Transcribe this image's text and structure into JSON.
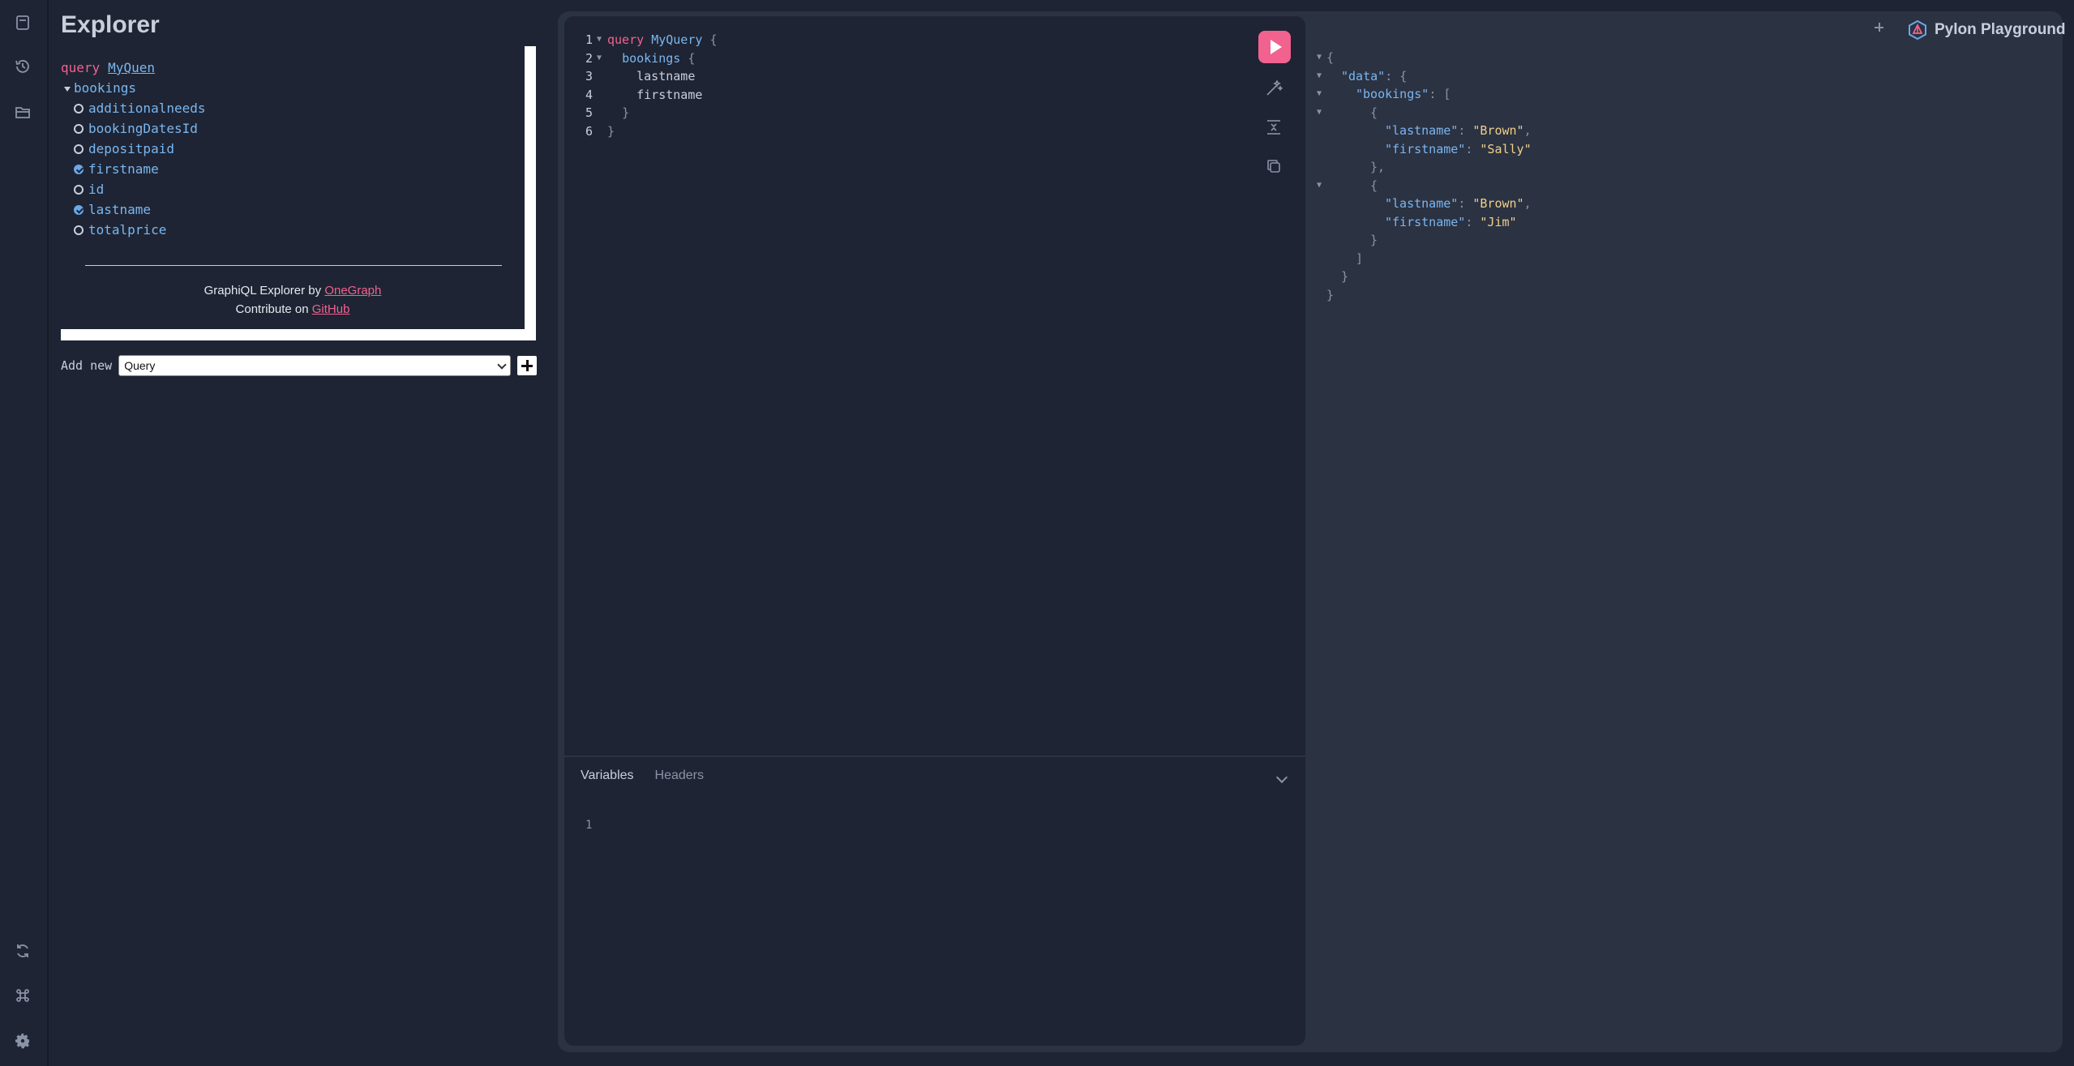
{
  "explorer": {
    "title": "Explorer",
    "operation_keyword": "query",
    "operation_name": "MyQuen",
    "root_field": "bookings",
    "fields": [
      {
        "name": "additionalneeds",
        "checked": false
      },
      {
        "name": "bookingDatesId",
        "checked": false
      },
      {
        "name": "depositpaid",
        "checked": false
      },
      {
        "name": "firstname",
        "checked": true
      },
      {
        "name": "id",
        "checked": false
      },
      {
        "name": "lastname",
        "checked": true
      },
      {
        "name": "totalprice",
        "checked": false
      }
    ],
    "credits_line1_prefix": "GraphiQL Explorer by ",
    "credits_line1_link": "OneGraph",
    "credits_line2_prefix": "Contribute on ",
    "credits_line2_link": "GitHub",
    "add_new_label": "Add new",
    "add_new_value": "Query"
  },
  "editor": {
    "lines": [
      {
        "n": "1",
        "fold": true
      },
      {
        "n": "2",
        "fold": true
      },
      {
        "n": "3",
        "fold": false
      },
      {
        "n": "4",
        "fold": false
      },
      {
        "n": "5",
        "fold": false
      },
      {
        "n": "6",
        "fold": false
      }
    ],
    "query_keyword": "query",
    "query_name": "MyQuery",
    "field_bookings": "bookings",
    "field_lastname": "lastname",
    "field_firstname": "firstname",
    "open_brace": "{",
    "close_brace": "}",
    "tabs": [
      "Variables",
      "Headers"
    ],
    "variables_line": "1"
  },
  "result": {
    "data_key": "\"data\"",
    "bookings_key": "\"bookings\"",
    "lastname_key": "\"lastname\"",
    "firstname_key": "\"firstname\"",
    "items": [
      {
        "lastname": "\"Brown\"",
        "firstname": "\"Sally\""
      },
      {
        "lastname": "\"Brown\"",
        "firstname": "\"Jim\""
      }
    ]
  },
  "brand": {
    "name": "Pylon Playground"
  },
  "colors": {
    "accent": "#f2628f",
    "field": "#7ab6f0",
    "string": "#f0cf8a",
    "background": "#1e2433",
    "panel": "#2b3242"
  }
}
